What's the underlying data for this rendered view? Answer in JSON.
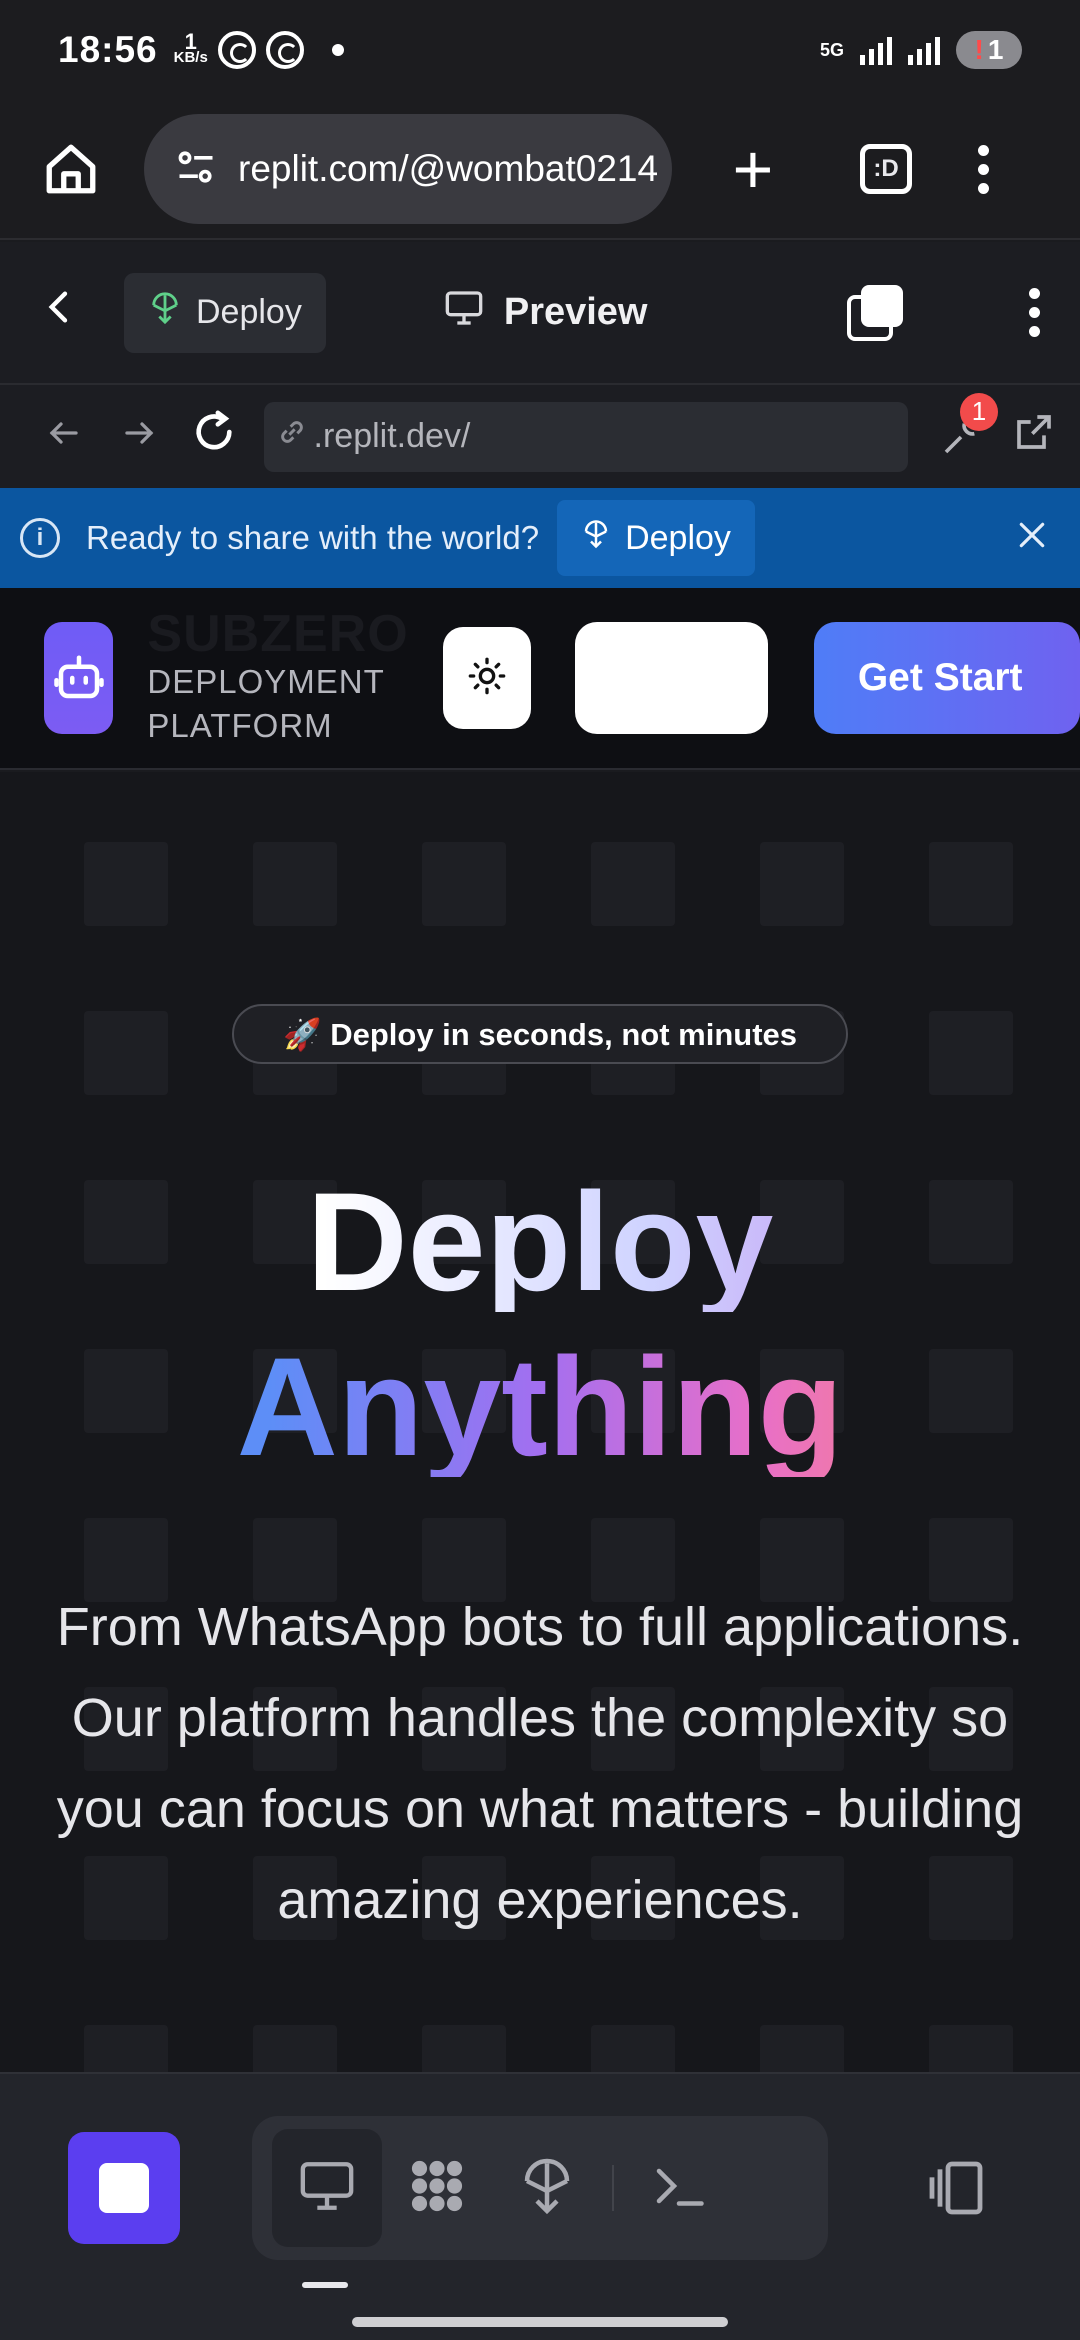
{
  "status": {
    "time": "18:56",
    "speed_value": "1",
    "speed_unit": "KB/s",
    "network": "5G",
    "battery_alert": "!",
    "battery_count": "1"
  },
  "browser": {
    "url": "replit.com/@wombat0214",
    "tab_label": ":D"
  },
  "replit": {
    "deploy_label": "Deploy",
    "preview_label": "Preview",
    "address": ".replit.dev/",
    "wrench_badge": "1",
    "banner_text": "Ready to share with the world?",
    "banner_button": "Deploy"
  },
  "site": {
    "brand_name": "SUBZERO",
    "brand_sub_1": "DEPLOYMENT",
    "brand_sub_2": "PLATFORM",
    "cta": "Get Start",
    "pill": "🚀 Deploy in seconds, not minutes",
    "hero_line1": "Deploy",
    "hero_line2": "Anything",
    "hero_desc": "From WhatsApp bots to full applications. Our platform handles the complexity so you can focus on what matters - building amazing experiences."
  },
  "colors": {
    "accent": "#5b3ef0",
    "banner": "#0b56a0",
    "cta_start": "#4f7df7",
    "cta_end": "#6f62f0"
  },
  "icons": [
    "home-icon",
    "site-settings-icon",
    "plus-icon",
    "tab-switcher-icon",
    "more-icon",
    "back-icon",
    "deploy-icon",
    "monitor-icon",
    "duplicate-icon",
    "arrow-left-icon",
    "arrow-right-icon",
    "reload-icon",
    "link-icon",
    "wrench-icon",
    "external-link-icon",
    "info-icon",
    "close-icon",
    "robot-icon",
    "sun-icon",
    "stop-icon",
    "apps-icon",
    "shell-icon",
    "panels-icon"
  ]
}
